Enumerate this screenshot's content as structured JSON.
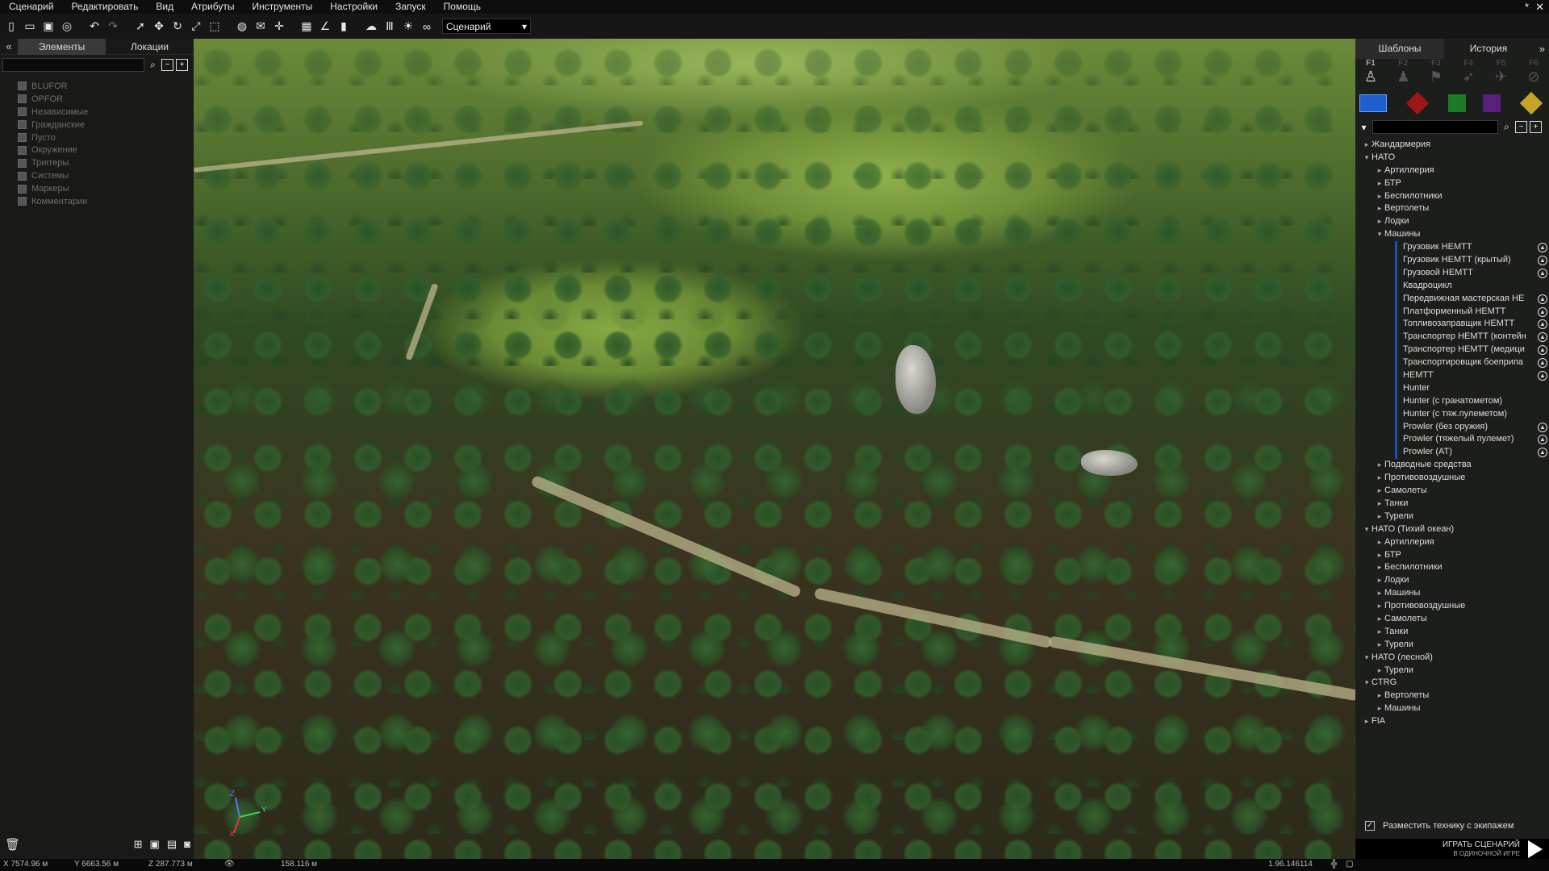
{
  "menubar": {
    "items": [
      "Сценарий",
      "Редактировать",
      "Вид",
      "Атрибуты",
      "Инструменты",
      "Настройки",
      "Запуск",
      "Помощь"
    ],
    "win_pin": "*",
    "win_close": "✕"
  },
  "toolbar": {
    "mode_select_value": "Сценарий",
    "buttons": [
      "new-file",
      "open-folder",
      "save",
      "publish",
      "undo",
      "redo",
      "select",
      "move",
      "rotate",
      "scale",
      "area-select",
      "globe",
      "map",
      "snap",
      "grid",
      "angle",
      "measure",
      "weather",
      "bars",
      "sun",
      "binoculars"
    ]
  },
  "left_panel": {
    "collapse": "«",
    "tabs": [
      "Элементы",
      "Локации"
    ],
    "active_tab": 0,
    "items": [
      "BLUFOR",
      "OPFOR",
      "Независимые",
      "Гражданские",
      "Пусто",
      "Окружение",
      "Триггеры",
      "Системы",
      "Маркеры",
      "Комментарии"
    ]
  },
  "right_panel": {
    "tabs": [
      "Шаблоны",
      "История"
    ],
    "active_tab": 0,
    "arrow": "»",
    "fkeys": [
      {
        "key": "F1",
        "icon": "soldier-icon",
        "active": true
      },
      {
        "key": "F2",
        "icon": "group-icon",
        "active": false
      },
      {
        "key": "F3",
        "icon": "flag-icon",
        "active": false
      },
      {
        "key": "F4",
        "icon": "waypoint-icon",
        "active": false
      },
      {
        "key": "F5",
        "icon": "helicopter-icon",
        "active": false
      },
      {
        "key": "F6",
        "icon": "empty-icon",
        "active": false
      }
    ],
    "sides": [
      {
        "name": "blufor",
        "color": "#1e5fd0"
      },
      {
        "name": "opfor",
        "color": "#a01616"
      },
      {
        "name": "independent",
        "color": "#1f7a28"
      },
      {
        "name": "civilian",
        "color": "#5a1f78"
      },
      {
        "name": "other",
        "color": "#c4a52a"
      }
    ],
    "tree": [
      {
        "level": 0,
        "label": "Жандармерия",
        "toggle": "▸"
      },
      {
        "level": 0,
        "label": "НАТО",
        "toggle": "▾"
      },
      {
        "level": 1,
        "label": "Артиллерия",
        "toggle": "▸"
      },
      {
        "level": 1,
        "label": "БТР",
        "toggle": "▸"
      },
      {
        "level": 1,
        "label": "Беспилотники",
        "toggle": "▸"
      },
      {
        "level": 1,
        "label": "Вертолеты",
        "toggle": "▸"
      },
      {
        "level": 1,
        "label": "Лодки",
        "toggle": "▸"
      },
      {
        "level": 1,
        "label": "Машины",
        "toggle": "▾"
      },
      {
        "level": 2,
        "label": "Грузовик HEMTT",
        "badge": true
      },
      {
        "level": 2,
        "label": "Грузовик HEMTT (крытый)",
        "badge": true
      },
      {
        "level": 2,
        "label": "Грузовой HEMTT",
        "badge": true
      },
      {
        "level": 2,
        "label": "Квадроцикл",
        "badge": false
      },
      {
        "level": 2,
        "label": "Передвижная мастерская HE",
        "badge": true
      },
      {
        "level": 2,
        "label": "Платформенный HEMTT",
        "badge": true
      },
      {
        "level": 2,
        "label": "Топливозаправщик HEMTT",
        "badge": true
      },
      {
        "level": 2,
        "label": "Транспортер HEMTT (контейн",
        "badge": true
      },
      {
        "level": 2,
        "label": "Транспортер HEMTT (медици",
        "badge": true
      },
      {
        "level": 2,
        "label": "Транспортировщик боеприпа",
        "badge": true
      },
      {
        "level": 2,
        "label": "HEMTT",
        "badge": true
      },
      {
        "level": 2,
        "label": "Hunter",
        "badge": false
      },
      {
        "level": 2,
        "label": "Hunter (с гранатометом)",
        "badge": false
      },
      {
        "level": 2,
        "label": "Hunter (с тяж.пулеметом)",
        "badge": false
      },
      {
        "level": 2,
        "label": "Prowler (без оружия)",
        "badge": true
      },
      {
        "level": 2,
        "label": "Prowler (тяжелый пулемет)",
        "badge": true
      },
      {
        "level": 2,
        "label": "Prowler (AT)",
        "badge": true
      },
      {
        "level": 1,
        "label": "Подводные средства",
        "toggle": "▸"
      },
      {
        "level": 1,
        "label": "Противовоздушные",
        "toggle": "▸"
      },
      {
        "level": 1,
        "label": "Самолеты",
        "toggle": "▸"
      },
      {
        "level": 1,
        "label": "Танки",
        "toggle": "▸"
      },
      {
        "level": 1,
        "label": "Турели",
        "toggle": "▸"
      },
      {
        "level": 0,
        "label": "НАТО (Тихий океан)",
        "toggle": "▾"
      },
      {
        "level": 1,
        "label": "Артиллерия",
        "toggle": "▸"
      },
      {
        "level": 1,
        "label": "БТР",
        "toggle": "▸"
      },
      {
        "level": 1,
        "label": "Беспилотники",
        "toggle": "▸"
      },
      {
        "level": 1,
        "label": "Лодки",
        "toggle": "▸"
      },
      {
        "level": 1,
        "label": "Машины",
        "toggle": "▸"
      },
      {
        "level": 1,
        "label": "Противовоздушные",
        "toggle": "▸"
      },
      {
        "level": 1,
        "label": "Самолеты",
        "toggle": "▸"
      },
      {
        "level": 1,
        "label": "Танки",
        "toggle": "▸"
      },
      {
        "level": 1,
        "label": "Турели",
        "toggle": "▸"
      },
      {
        "level": 0,
        "label": "НАТО (лесной)",
        "toggle": "▾"
      },
      {
        "level": 1,
        "label": "Турели",
        "toggle": "▸"
      },
      {
        "level": 0,
        "label": "CTRG",
        "toggle": "▾"
      },
      {
        "level": 1,
        "label": "Вертолеты",
        "toggle": "▸"
      },
      {
        "level": 1,
        "label": "Машины",
        "toggle": "▸"
      },
      {
        "level": 0,
        "label": "FIA",
        "toggle": "▸"
      }
    ],
    "footer_checkbox_label": "Разместить технику с экипажем",
    "footer_checked": true
  },
  "play": {
    "label": "ИГРАТЬ СЦЕНАРИЙ",
    "sublabel": "В ОДИНОЧНОЙ ИГРЕ"
  },
  "statusbar": {
    "x": "X 7574.96 м",
    "y": "Y 6663.56 м",
    "z": "Z 287.773 м",
    "dist": "158.116 м",
    "version": "1.96.146114"
  }
}
